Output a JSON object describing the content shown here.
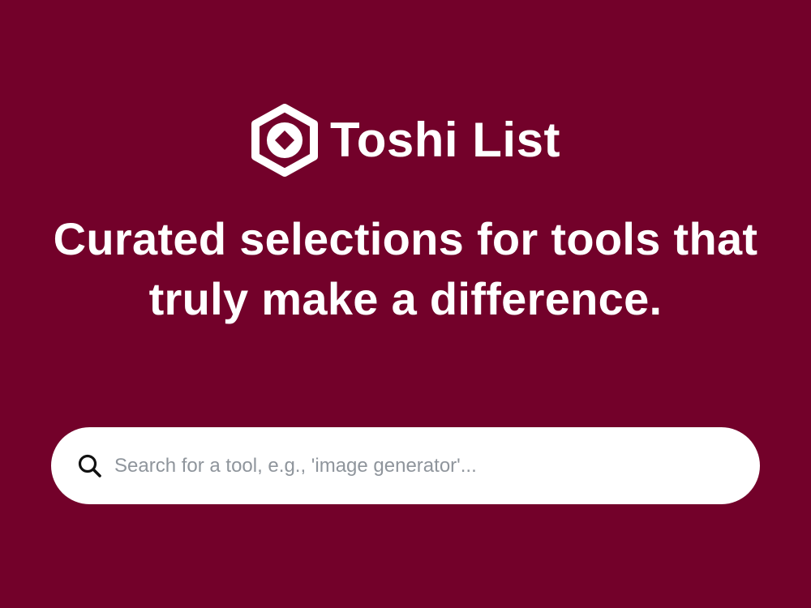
{
  "brand": {
    "name": "Toshi List",
    "logo_icon": "hexagon-diamond-logo"
  },
  "hero": {
    "headline": "Curated selections for tools that truly make a difference."
  },
  "search": {
    "icon": "search-icon",
    "value": "",
    "placeholder": "Search for a tool, e.g., 'image generator'..."
  },
  "colors": {
    "background": "#73012a",
    "text": "#ffffff",
    "search_background": "#ffffff",
    "placeholder": "#8f959c"
  }
}
